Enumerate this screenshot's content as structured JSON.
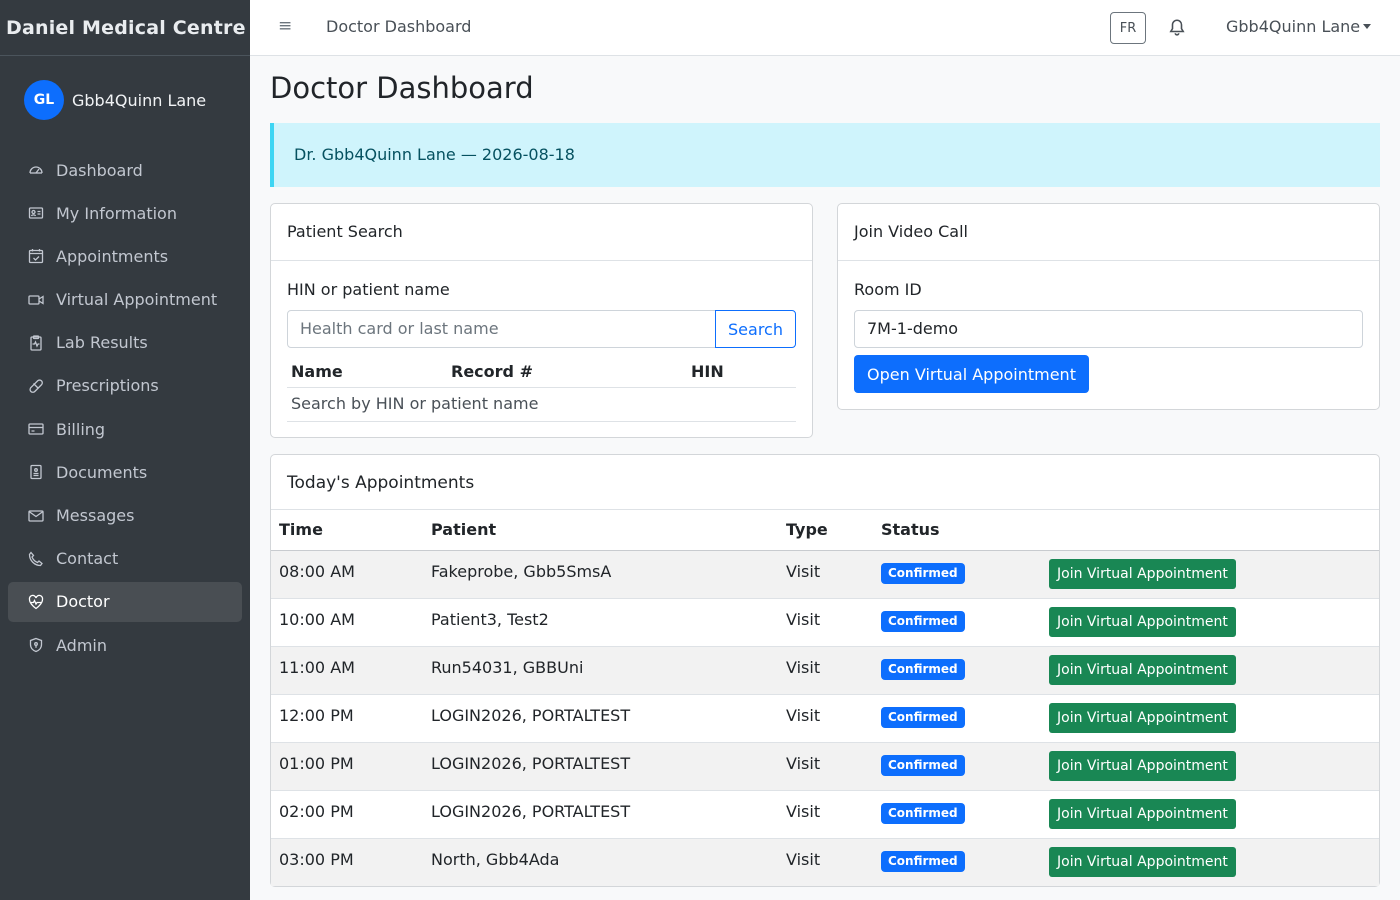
{
  "brand": "Daniel Medical Centre",
  "user": {
    "initials": "GL",
    "name": "Gbb4Quinn Lane"
  },
  "sidebar": {
    "items": [
      {
        "label": "Dashboard",
        "icon": "speedometer-icon"
      },
      {
        "label": "My Information",
        "icon": "id-card-icon"
      },
      {
        "label": "Appointments",
        "icon": "calendar-check-icon"
      },
      {
        "label": "Virtual Appointment",
        "icon": "camera-video-icon"
      },
      {
        "label": "Lab Results",
        "icon": "clipboard-pulse-icon"
      },
      {
        "label": "Prescriptions",
        "icon": "capsule-icon"
      },
      {
        "label": "Billing",
        "icon": "credit-card-icon"
      },
      {
        "label": "Documents",
        "icon": "file-icon"
      },
      {
        "label": "Messages",
        "icon": "envelope-icon"
      },
      {
        "label": "Contact",
        "icon": "phone-icon"
      },
      {
        "label": "Doctor",
        "icon": "heart-pulse-icon",
        "active": true
      },
      {
        "label": "Admin",
        "icon": "shield-icon"
      }
    ]
  },
  "topbar": {
    "title": "Doctor Dashboard",
    "lang": "FR",
    "user_menu": "Gbb4Quinn Lane"
  },
  "main": {
    "title": "Doctor Dashboard",
    "alert": "Dr. Gbb4Quinn Lane — 2026-08-18"
  },
  "patient_search": {
    "title": "Patient Search",
    "label": "HIN or patient name",
    "placeholder": "Health card or last name",
    "button": "Search",
    "columns": [
      "Name",
      "Record #",
      "HIN"
    ],
    "empty": "Search by HIN or patient name"
  },
  "video_call": {
    "title": "Join Video Call",
    "label": "Room ID",
    "value": "7M-1-demo",
    "button": "Open Virtual Appointment"
  },
  "appointments": {
    "title": "Today's Appointments",
    "columns": [
      "Time",
      "Patient",
      "Type",
      "Status",
      ""
    ],
    "rows": [
      {
        "time": "08:00 AM",
        "patient": "Fakeprobe, Gbb5SmsA",
        "type": "Visit",
        "status": "Confirmed",
        "action": "Join Virtual Appointment"
      },
      {
        "time": "10:00 AM",
        "patient": "Patient3, Test2",
        "type": "Visit",
        "status": "Confirmed",
        "action": "Join Virtual Appointment"
      },
      {
        "time": "11:00 AM",
        "patient": "Run54031, GBBUni",
        "type": "Visit",
        "status": "Confirmed",
        "action": "Join Virtual Appointment"
      },
      {
        "time": "12:00 PM",
        "patient": "LOGIN2026, PORTALTEST",
        "type": "Visit",
        "status": "Confirmed",
        "action": "Join Virtual Appointment"
      },
      {
        "time": "01:00 PM",
        "patient": "LOGIN2026, PORTALTEST",
        "type": "Visit",
        "status": "Confirmed",
        "action": "Join Virtual Appointment"
      },
      {
        "time": "02:00 PM",
        "patient": "LOGIN2026, PORTALTEST",
        "type": "Visit",
        "status": "Confirmed",
        "action": "Join Virtual Appointment"
      },
      {
        "time": "03:00 PM",
        "patient": "North, Gbb4Ada",
        "type": "Visit",
        "status": "Confirmed",
        "action": "Join Virtual Appointment"
      }
    ]
  },
  "colors": {
    "primary": "#0d6efd",
    "success": "#198754",
    "sidebar": "#343a40",
    "alert_bg": "#cff4fc"
  }
}
